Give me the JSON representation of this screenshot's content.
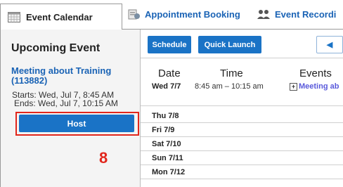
{
  "tabs": [
    {
      "label": "Event Calendar",
      "icon": "calendar-icon",
      "active": true
    },
    {
      "label": "Appointment Booking",
      "icon": "appointment-icon",
      "active": false
    },
    {
      "label": "Event Recordi",
      "icon": "people-icon",
      "active": false
    }
  ],
  "left": {
    "title": "Upcoming Event",
    "meeting_title": "Meeting about Training (113882)",
    "starts": "Starts: Wed, Jul 7, 8:45 AM",
    "ends": "Ends: Wed, Jul 7, 10:15 AM",
    "host_label": "Host",
    "annotation": "8"
  },
  "toolbar": {
    "schedule_label": "Schedule",
    "quick_launch_label": "Quick Launch",
    "prev_icon": "◀"
  },
  "table": {
    "headers": {
      "date": "Date",
      "time": "Time",
      "events": "Events"
    },
    "first_row": {
      "date": "Wed 7/7",
      "time": "8:45 am – 10:15 am",
      "event_plus": "+",
      "event": "Meeting ab"
    },
    "days": [
      "Thu 7/8",
      "Fri 7/9",
      "Sat 7/10",
      "Sun 7/11",
      "Mon 7/12"
    ]
  },
  "colors": {
    "accent": "#1a73c6",
    "link": "#1a63b5",
    "highlight": "#e1261c"
  }
}
